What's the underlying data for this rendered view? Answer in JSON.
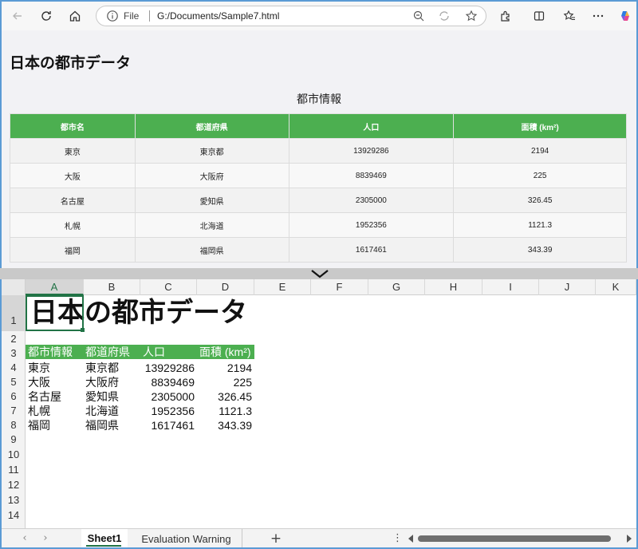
{
  "browser": {
    "address": {
      "scheme_label": "File",
      "url": "G:/Documents/Sample7.html"
    },
    "page": {
      "title": "日本の都市データ",
      "caption": "都市情報",
      "columns": [
        "都市名",
        "都道府県",
        "人口",
        "面積 (km²)"
      ],
      "rows": [
        [
          "東京",
          "東京都",
          "13929286",
          "2194"
        ],
        [
          "大阪",
          "大阪府",
          "8839469",
          "225"
        ],
        [
          "名古屋",
          "愛知県",
          "2305000",
          "326.45"
        ],
        [
          "札幌",
          "北海道",
          "1952356",
          "1121.3"
        ],
        [
          "福岡",
          "福岡県",
          "1617461",
          "343.39"
        ]
      ],
      "header_color": "#4caf50"
    }
  },
  "spreadsheet": {
    "columns": [
      "A",
      "B",
      "C",
      "D",
      "E",
      "F",
      "G",
      "H",
      "I",
      "J",
      "K"
    ],
    "active_column": "A",
    "row_numbers": [
      "1",
      "2",
      "3",
      "4",
      "5",
      "6",
      "7",
      "8",
      "9",
      "10",
      "11",
      "12",
      "13",
      "14"
    ],
    "active_row": "1",
    "title": "日本の都市データ",
    "header": [
      "都市情報",
      "都道府県",
      "人口",
      "面積 (km²)"
    ],
    "rows": [
      [
        "東京",
        "東京都",
        "13929286",
        "2194"
      ],
      [
        "大阪",
        "大阪府",
        "8839469",
        "225"
      ],
      [
        "名古屋",
        "愛知県",
        "2305000",
        "326.45"
      ],
      [
        "札幌",
        "北海道",
        "1952356",
        "1121.3"
      ],
      [
        "福岡",
        "福岡県",
        "1617461",
        "343.39"
      ]
    ],
    "tabs": [
      "Sheet1",
      "Evaluation Warning"
    ],
    "active_tab": "Sheet1",
    "accent_color": "#217346"
  },
  "icons": {
    "toolbar": [
      "back-icon",
      "refresh-icon",
      "home-icon",
      "info-icon",
      "zoom-out-icon",
      "read-aloud-icon",
      "favorite-star-icon",
      "extensions-icon",
      "split-screen-icon",
      "favorites-icon",
      "more-icon",
      "copilot-icon"
    ]
  }
}
